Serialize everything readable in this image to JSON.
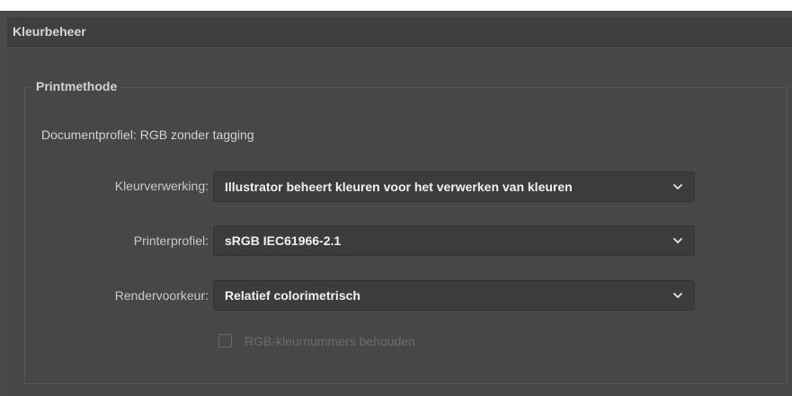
{
  "section": {
    "title": "Kleurbeheer"
  },
  "print_method": {
    "legend": "Printmethode",
    "document_profile": "Documentprofiel: RGB zonder tagging",
    "rows": [
      {
        "label": "Kleurverwerking:",
        "value": "Illustrator beheert kleuren voor het verwerken van kleuren"
      },
      {
        "label": "Printerprofiel:",
        "value": "sRGB IEC61966-2.1"
      },
      {
        "label": "Rendervoorkeur:",
        "value": "Relatief colorimetrisch"
      }
    ],
    "checkbox": {
      "label": "RGB-kleurnummers behouden",
      "checked": false,
      "enabled": false
    }
  },
  "icons": {
    "dropdown_arrow": "chevron-down-icon"
  },
  "colors": {
    "panel_bg": "#474747",
    "header_bg": "#3f3f3f",
    "dropdown_bg": "#3c3c3c",
    "text": "#d2d2d2",
    "value_text": "#f0f0f0",
    "disabled_text": "#6c6c6c"
  }
}
